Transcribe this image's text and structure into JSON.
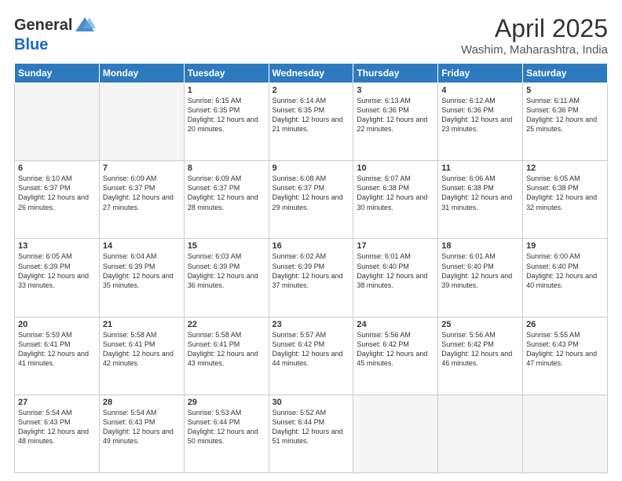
{
  "logo": {
    "general": "General",
    "blue": "Blue"
  },
  "title": "April 2025",
  "location": "Washim, Maharashtra, India",
  "days_of_week": [
    "Sunday",
    "Monday",
    "Tuesday",
    "Wednesday",
    "Thursday",
    "Friday",
    "Saturday"
  ],
  "weeks": [
    [
      {
        "day": "",
        "sunrise": "",
        "sunset": "",
        "daylight": "",
        "empty": true
      },
      {
        "day": "",
        "sunrise": "",
        "sunset": "",
        "daylight": "",
        "empty": true
      },
      {
        "day": "1",
        "sunrise": "Sunrise: 6:15 AM",
        "sunset": "Sunset: 6:35 PM",
        "daylight": "Daylight: 12 hours and 20 minutes."
      },
      {
        "day": "2",
        "sunrise": "Sunrise: 6:14 AM",
        "sunset": "Sunset: 6:35 PM",
        "daylight": "Daylight: 12 hours and 21 minutes."
      },
      {
        "day": "3",
        "sunrise": "Sunrise: 6:13 AM",
        "sunset": "Sunset: 6:36 PM",
        "daylight": "Daylight: 12 hours and 22 minutes."
      },
      {
        "day": "4",
        "sunrise": "Sunrise: 6:12 AM",
        "sunset": "Sunset: 6:36 PM",
        "daylight": "Daylight: 12 hours and 23 minutes."
      },
      {
        "day": "5",
        "sunrise": "Sunrise: 6:11 AM",
        "sunset": "Sunset: 6:36 PM",
        "daylight": "Daylight: 12 hours and 25 minutes."
      }
    ],
    [
      {
        "day": "6",
        "sunrise": "Sunrise: 6:10 AM",
        "sunset": "Sunset: 6:37 PM",
        "daylight": "Daylight: 12 hours and 26 minutes."
      },
      {
        "day": "7",
        "sunrise": "Sunrise: 6:09 AM",
        "sunset": "Sunset: 6:37 PM",
        "daylight": "Daylight: 12 hours and 27 minutes."
      },
      {
        "day": "8",
        "sunrise": "Sunrise: 6:09 AM",
        "sunset": "Sunset: 6:37 PM",
        "daylight": "Daylight: 12 hours and 28 minutes."
      },
      {
        "day": "9",
        "sunrise": "Sunrise: 6:08 AM",
        "sunset": "Sunset: 6:37 PM",
        "daylight": "Daylight: 12 hours and 29 minutes."
      },
      {
        "day": "10",
        "sunrise": "Sunrise: 6:07 AM",
        "sunset": "Sunset: 6:38 PM",
        "daylight": "Daylight: 12 hours and 30 minutes."
      },
      {
        "day": "11",
        "sunrise": "Sunrise: 6:06 AM",
        "sunset": "Sunset: 6:38 PM",
        "daylight": "Daylight: 12 hours and 31 minutes."
      },
      {
        "day": "12",
        "sunrise": "Sunrise: 6:05 AM",
        "sunset": "Sunset: 6:38 PM",
        "daylight": "Daylight: 12 hours and 32 minutes."
      }
    ],
    [
      {
        "day": "13",
        "sunrise": "Sunrise: 6:05 AM",
        "sunset": "Sunset: 6:39 PM",
        "daylight": "Daylight: 12 hours and 33 minutes."
      },
      {
        "day": "14",
        "sunrise": "Sunrise: 6:04 AM",
        "sunset": "Sunset: 6:39 PM",
        "daylight": "Daylight: 12 hours and 35 minutes."
      },
      {
        "day": "15",
        "sunrise": "Sunrise: 6:03 AM",
        "sunset": "Sunset: 6:39 PM",
        "daylight": "Daylight: 12 hours and 36 minutes."
      },
      {
        "day": "16",
        "sunrise": "Sunrise: 6:02 AM",
        "sunset": "Sunset: 6:39 PM",
        "daylight": "Daylight: 12 hours and 37 minutes."
      },
      {
        "day": "17",
        "sunrise": "Sunrise: 6:01 AM",
        "sunset": "Sunset: 6:40 PM",
        "daylight": "Daylight: 12 hours and 38 minutes."
      },
      {
        "day": "18",
        "sunrise": "Sunrise: 6:01 AM",
        "sunset": "Sunset: 6:40 PM",
        "daylight": "Daylight: 12 hours and 39 minutes."
      },
      {
        "day": "19",
        "sunrise": "Sunrise: 6:00 AM",
        "sunset": "Sunset: 6:40 PM",
        "daylight": "Daylight: 12 hours and 40 minutes."
      }
    ],
    [
      {
        "day": "20",
        "sunrise": "Sunrise: 5:59 AM",
        "sunset": "Sunset: 6:41 PM",
        "daylight": "Daylight: 12 hours and 41 minutes."
      },
      {
        "day": "21",
        "sunrise": "Sunrise: 5:58 AM",
        "sunset": "Sunset: 6:41 PM",
        "daylight": "Daylight: 12 hours and 42 minutes."
      },
      {
        "day": "22",
        "sunrise": "Sunrise: 5:58 AM",
        "sunset": "Sunset: 6:41 PM",
        "daylight": "Daylight: 12 hours and 43 minutes."
      },
      {
        "day": "23",
        "sunrise": "Sunrise: 5:57 AM",
        "sunset": "Sunset: 6:42 PM",
        "daylight": "Daylight: 12 hours and 44 minutes."
      },
      {
        "day": "24",
        "sunrise": "Sunrise: 5:56 AM",
        "sunset": "Sunset: 6:42 PM",
        "daylight": "Daylight: 12 hours and 45 minutes."
      },
      {
        "day": "25",
        "sunrise": "Sunrise: 5:56 AM",
        "sunset": "Sunset: 6:42 PM",
        "daylight": "Daylight: 12 hours and 46 minutes."
      },
      {
        "day": "26",
        "sunrise": "Sunrise: 5:55 AM",
        "sunset": "Sunset: 6:43 PM",
        "daylight": "Daylight: 12 hours and 47 minutes."
      }
    ],
    [
      {
        "day": "27",
        "sunrise": "Sunrise: 5:54 AM",
        "sunset": "Sunset: 6:43 PM",
        "daylight": "Daylight: 12 hours and 48 minutes."
      },
      {
        "day": "28",
        "sunrise": "Sunrise: 5:54 AM",
        "sunset": "Sunset: 6:43 PM",
        "daylight": "Daylight: 12 hours and 49 minutes."
      },
      {
        "day": "29",
        "sunrise": "Sunrise: 5:53 AM",
        "sunset": "Sunset: 6:44 PM",
        "daylight": "Daylight: 12 hours and 50 minutes."
      },
      {
        "day": "30",
        "sunrise": "Sunrise: 5:52 AM",
        "sunset": "Sunset: 6:44 PM",
        "daylight": "Daylight: 12 hours and 51 minutes."
      },
      {
        "day": "",
        "sunrise": "",
        "sunset": "",
        "daylight": "",
        "empty": true
      },
      {
        "day": "",
        "sunrise": "",
        "sunset": "",
        "daylight": "",
        "empty": true
      },
      {
        "day": "",
        "sunrise": "",
        "sunset": "",
        "daylight": "",
        "empty": true
      }
    ]
  ]
}
